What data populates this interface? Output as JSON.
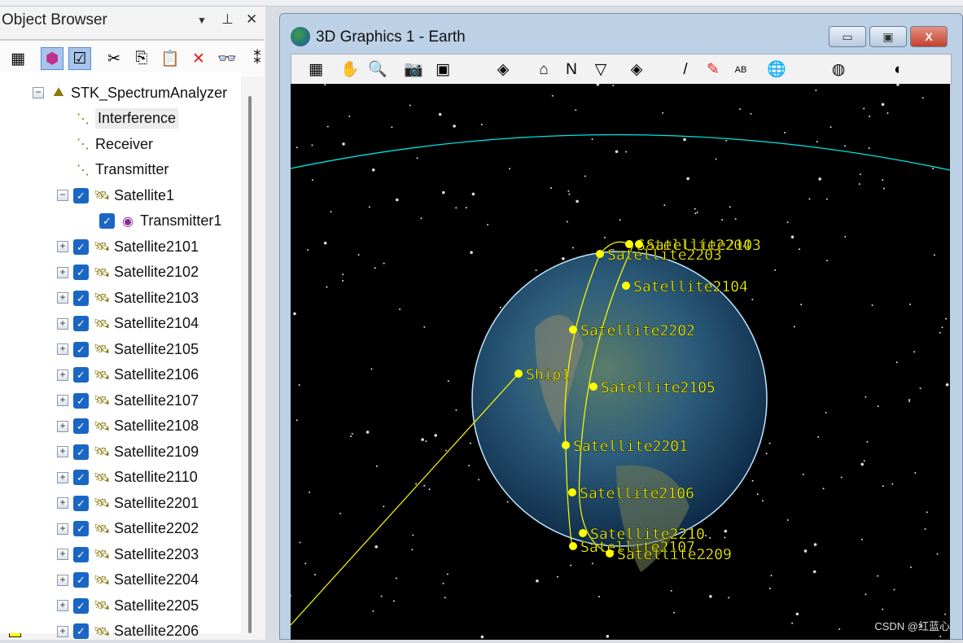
{
  "object_browser": {
    "title": "Object Browser",
    "header_icons": [
      "dropdown-arrow-icon",
      "pin-icon",
      "close-icon"
    ],
    "toolbar": [
      "properties-icon",
      "color-legend-icon",
      "checkbox-toggle-icon",
      "cut-icon",
      "copy-icon",
      "paste-icon",
      "delete-icon",
      "find-binoculars-icon",
      "overflow-icon"
    ],
    "tree": [
      {
        "label": "STK_SpectrumAnalyzer",
        "icon": "scenario-icon",
        "level": 0,
        "expander": "minus"
      },
      {
        "label": "Interference",
        "icon": "analysis-icon",
        "level": 1,
        "selected": true
      },
      {
        "label": "Receiver",
        "icon": "analysis-icon",
        "level": 1
      },
      {
        "label": "Transmitter",
        "icon": "analysis-icon",
        "level": 1
      },
      {
        "label": "Satellite1",
        "icon": "satellite-icon",
        "level": 1,
        "expander": "minus",
        "checked": true,
        "color": "#00ffff"
      },
      {
        "label": "Transmitter1",
        "icon": "transmitter-icon",
        "level": 2,
        "checked": true,
        "color": "#ffffff"
      },
      {
        "label": "Satellite2101",
        "icon": "satellite-icon",
        "level": 1,
        "expander": "plus",
        "checked": true,
        "color": "#ffff00"
      },
      {
        "label": "Satellite2102",
        "icon": "satellite-icon",
        "level": 1,
        "expander": "plus",
        "checked": true,
        "color": "#ffff00"
      },
      {
        "label": "Satellite2103",
        "icon": "satellite-icon",
        "level": 1,
        "expander": "plus",
        "checked": true,
        "color": "#ffff00"
      },
      {
        "label": "Satellite2104",
        "icon": "satellite-icon",
        "level": 1,
        "expander": "plus",
        "checked": true,
        "color": "#ffff00"
      },
      {
        "label": "Satellite2105",
        "icon": "satellite-icon",
        "level": 1,
        "expander": "plus",
        "checked": true,
        "color": "#ffff00"
      },
      {
        "label": "Satellite2106",
        "icon": "satellite-icon",
        "level": 1,
        "expander": "plus",
        "checked": true,
        "color": "#ffff00"
      },
      {
        "label": "Satellite2107",
        "icon": "satellite-icon",
        "level": 1,
        "expander": "plus",
        "checked": true,
        "color": "#ffff00"
      },
      {
        "label": "Satellite2108",
        "icon": "satellite-icon",
        "level": 1,
        "expander": "plus",
        "checked": true,
        "color": "#ffff00"
      },
      {
        "label": "Satellite2109",
        "icon": "satellite-icon",
        "level": 1,
        "expander": "plus",
        "checked": true,
        "color": "#ffff00"
      },
      {
        "label": "Satellite2110",
        "icon": "satellite-icon",
        "level": 1,
        "expander": "plus",
        "checked": true,
        "color": "#ffff00"
      },
      {
        "label": "Satellite2201",
        "icon": "satellite-icon",
        "level": 1,
        "expander": "plus",
        "checked": true,
        "color": "#ffff00"
      },
      {
        "label": "Satellite2202",
        "icon": "satellite-icon",
        "level": 1,
        "expander": "plus",
        "checked": true,
        "color": "#ffff00"
      },
      {
        "label": "Satellite2203",
        "icon": "satellite-icon",
        "level": 1,
        "expander": "plus",
        "checked": true,
        "color": "#ffff00"
      },
      {
        "label": "Satellite2204",
        "icon": "satellite-icon",
        "level": 1,
        "expander": "plus",
        "checked": true,
        "color": "#ffff00"
      },
      {
        "label": "Satellite2205",
        "icon": "satellite-icon",
        "level": 1,
        "expander": "plus",
        "checked": true,
        "color": "#ffff00"
      },
      {
        "label": "Satellite2206",
        "icon": "satellite-icon",
        "level": 1,
        "expander": "plus",
        "checked": true,
        "color": "#ffff00"
      }
    ]
  },
  "graphics_window": {
    "title": "3D Graphics 1 - Earth",
    "buttons": [
      "minimize-button",
      "restore-button",
      "close-button"
    ],
    "toolbar": [
      "properties-icon",
      "pan-hand-icon",
      "zoom-icon",
      "snapshot-icon",
      "record-movie-icon",
      "view-from-icon",
      "home-view-icon",
      "north-view-icon",
      "orient-down-icon",
      "view-to-icon",
      "highlighter-icon",
      "pencil-icon",
      "measure-ab-icon",
      "globe-menu-icon",
      "globe-layer-icon",
      "globe-download-icon"
    ],
    "scene": {
      "label_color": "#ffff00",
      "equator_color": "#00e5e5",
      "labels": [
        "Satellite2204",
        "Satellite2103",
        "Satellite2203",
        "Satellite2104",
        "Satellite2202",
        "Ship1",
        "Satellite2105",
        "Satellite2201",
        "Satellite2106",
        "Satellite2210",
        "Satellite2107",
        "Satellite2209"
      ]
    }
  },
  "watermark": "CSDN @红蓝心"
}
